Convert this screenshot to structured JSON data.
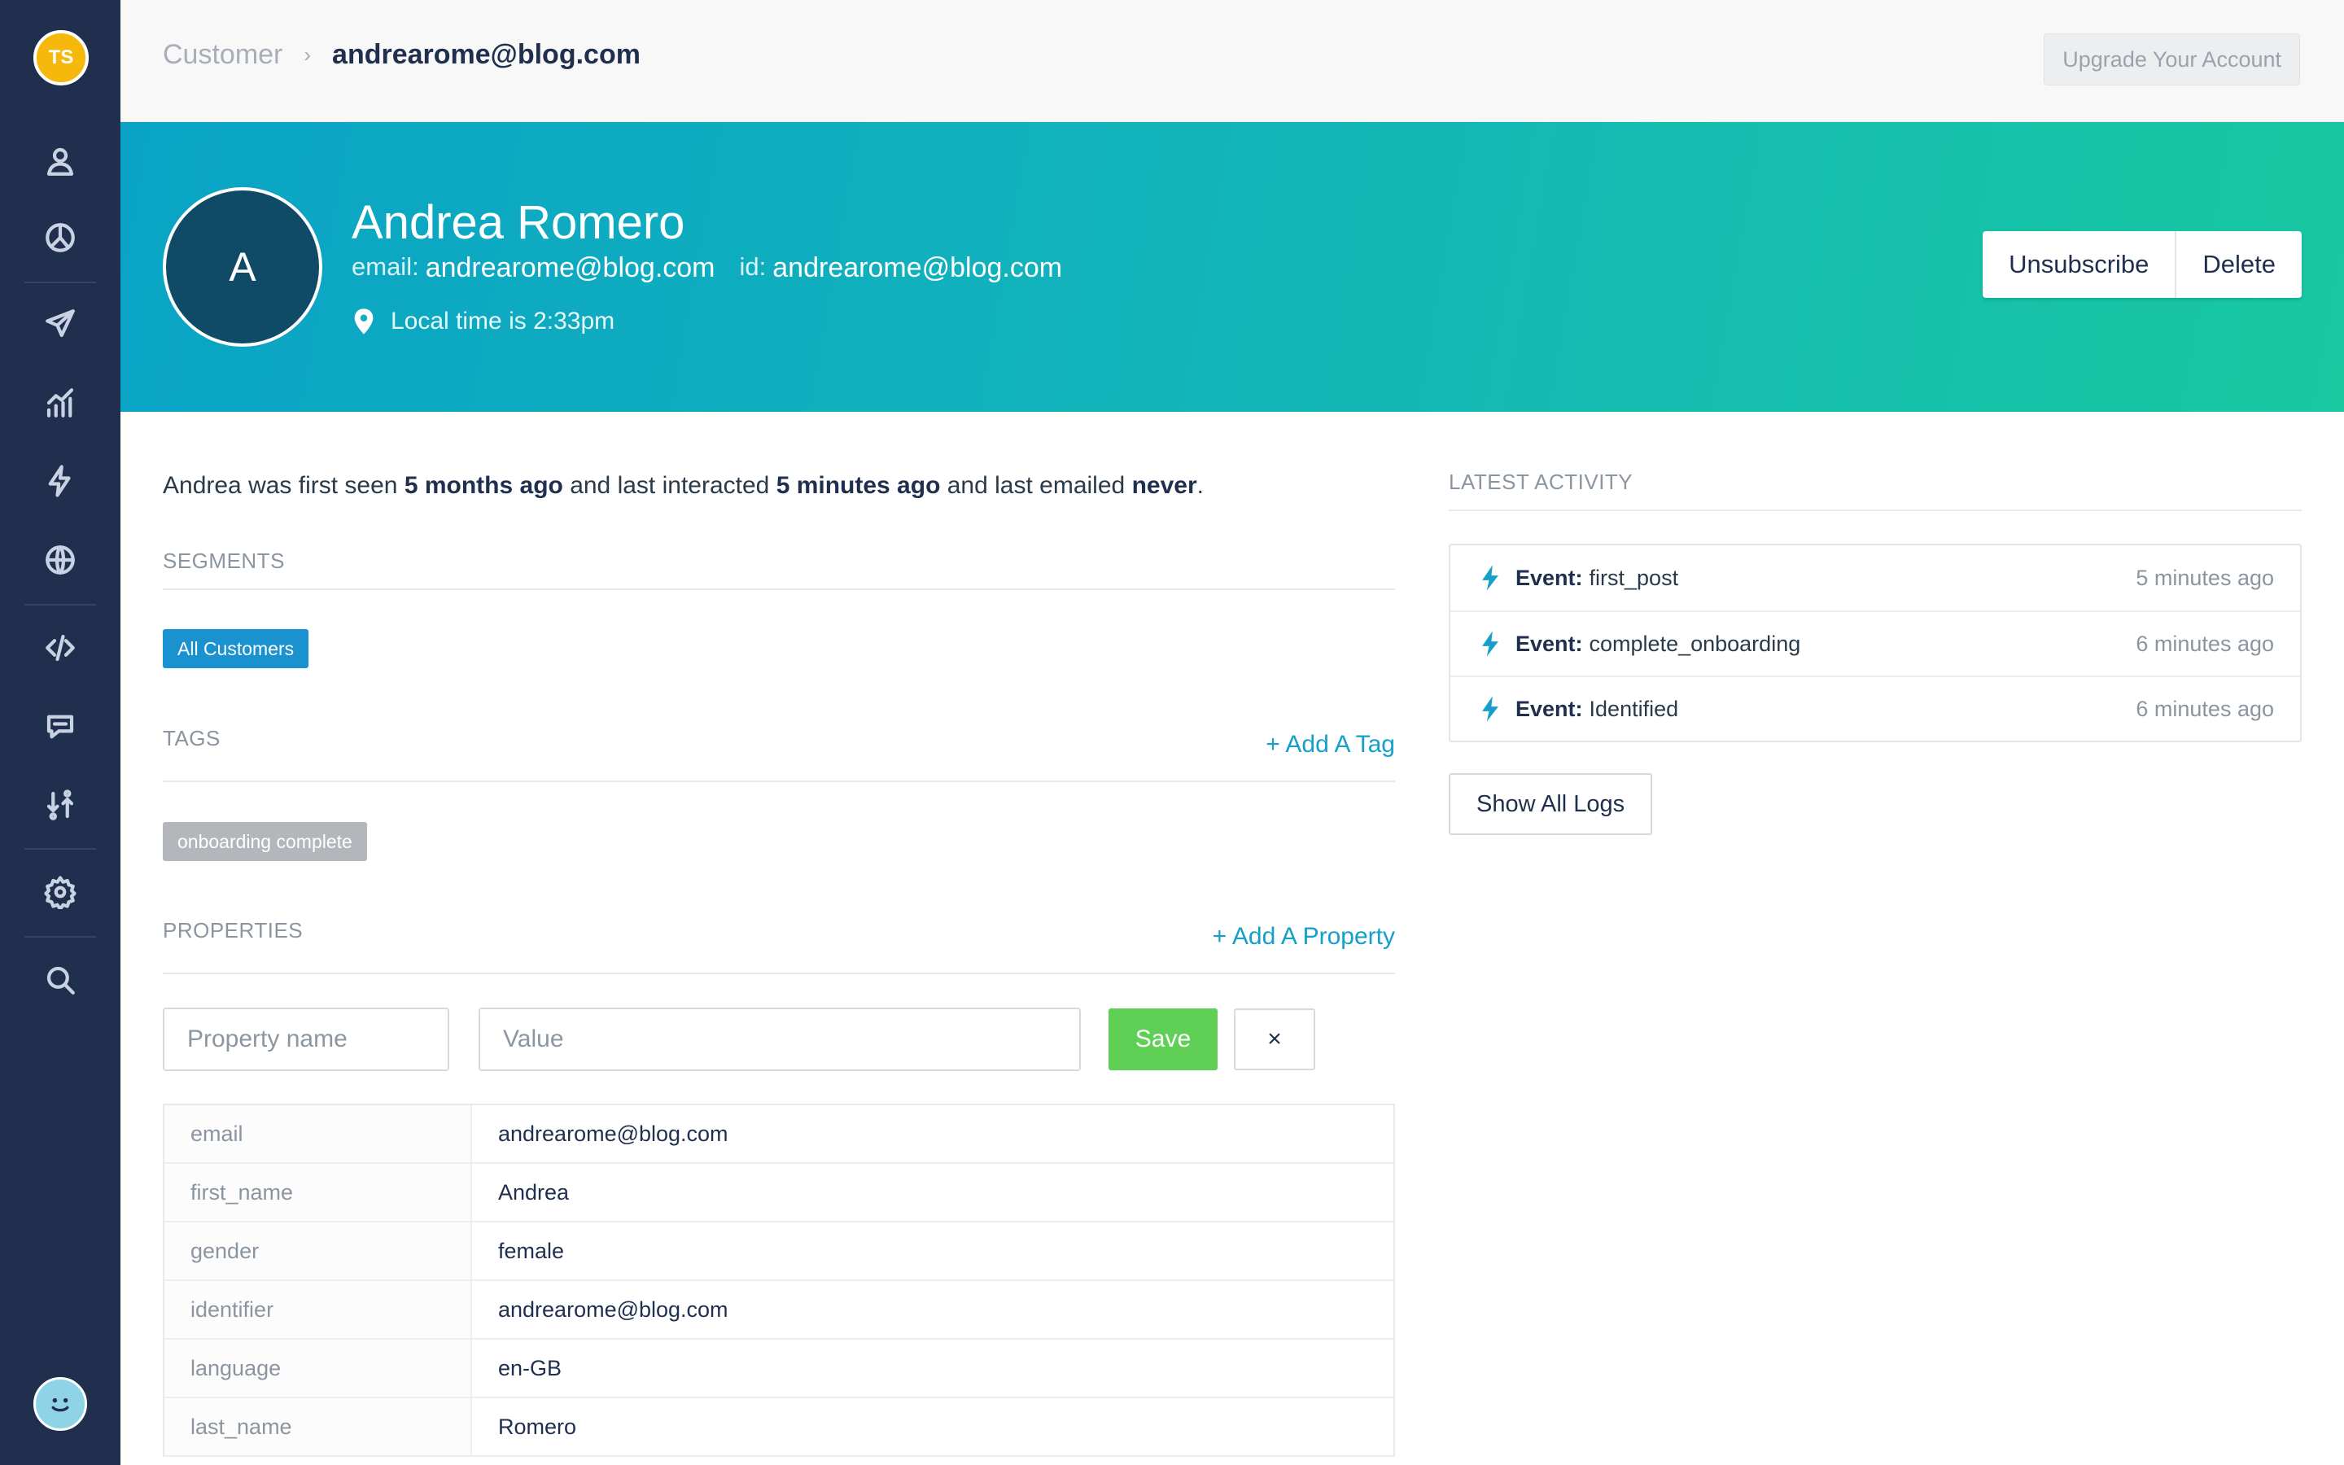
{
  "user": {
    "initials": "TS"
  },
  "header": {
    "breadcrumb_root": "Customer",
    "breadcrumb_separator": "›",
    "breadcrumb_current": "andrearome@blog.com",
    "upgrade_label": "Upgrade Your Account"
  },
  "sidebar": {
    "items": [
      {
        "icon": "person-icon"
      },
      {
        "icon": "pie-chart-icon"
      },
      {
        "icon": "paper-plane-icon"
      },
      {
        "icon": "trend-chart-icon"
      },
      {
        "icon": "lightning-icon"
      },
      {
        "icon": "globe-icon"
      },
      {
        "icon": "code-icon"
      },
      {
        "icon": "chat-bubble-icon"
      },
      {
        "icon": "sort-arrows-icon"
      },
      {
        "icon": "gear-icon"
      },
      {
        "icon": "search-icon"
      }
    ]
  },
  "profile": {
    "avatar_letter": "A",
    "name": "Andrea Romero",
    "email_label": "email:",
    "email": "andrearome@blog.com",
    "id_label": "id:",
    "id": "andrearome@blog.com",
    "local_time": "Local time is 2:33pm",
    "unsubscribe_label": "Unsubscribe",
    "delete_label": "Delete"
  },
  "summary": {
    "prefix": "Andrea was first seen",
    "first_seen": "5 months ago",
    "mid": "and last interacted",
    "last_interacted": "5 minutes ago",
    "mid2": "and last emailed",
    "last_emailed": "never",
    "suffix": "."
  },
  "segments": {
    "title": "SEGMENTS",
    "items": [
      "All Customers"
    ]
  },
  "tags": {
    "title": "TAGS",
    "add_label": "+ Add A Tag",
    "items": [
      "onboarding complete"
    ]
  },
  "properties": {
    "title": "PROPERTIES",
    "add_label": "+ Add A Property",
    "name_placeholder": "Property name",
    "value_placeholder": "Value",
    "save_label": "Save",
    "cancel_label": "×",
    "rows": [
      {
        "key": "email",
        "value": "andrearome@blog.com"
      },
      {
        "key": "first_name",
        "value": "Andrea"
      },
      {
        "key": "gender",
        "value": "female"
      },
      {
        "key": "identifier",
        "value": "andrearome@blog.com"
      },
      {
        "key": "language",
        "value": "en-GB"
      },
      {
        "key": "last_name",
        "value": "Romero"
      }
    ]
  },
  "activity": {
    "title": "LATEST ACTIVITY",
    "items": [
      {
        "label": "Event:",
        "name": "first_post",
        "time": "5 minutes ago"
      },
      {
        "label": "Event:",
        "name": "complete_onboarding",
        "time": "6 minutes ago"
      },
      {
        "label": "Event:",
        "name": "Identified",
        "time": "6 minutes ago"
      }
    ],
    "show_all_label": "Show All Logs"
  },
  "colors": {
    "sidebar": "#1f2f4d",
    "accent": "#14a0c7",
    "save": "#5fcf55",
    "segment_chip": "#1b92d0",
    "tag_chip": "#b3b6ba"
  }
}
